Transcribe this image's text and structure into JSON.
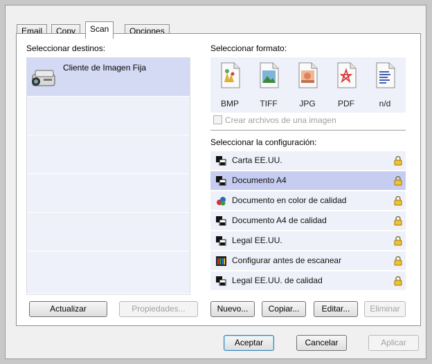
{
  "tabs": [
    {
      "label": "Email"
    },
    {
      "label": "Copy"
    },
    {
      "label": "Scan",
      "active": true
    },
    {
      "label": "Opciones"
    }
  ],
  "destinations": {
    "heading": "Seleccionar destinos:",
    "items": [
      "Cliente de Imagen Fija"
    ],
    "icon": "scanner-icon"
  },
  "format": {
    "heading": "Seleccionar formato:",
    "items": [
      {
        "label": "BMP",
        "icon": "bmp-file-icon"
      },
      {
        "label": "TIFF",
        "icon": "tiff-file-icon"
      },
      {
        "label": "JPG",
        "icon": "jpg-file-icon"
      },
      {
        "label": "PDF",
        "icon": "pdf-file-icon"
      },
      {
        "label": "n/d",
        "icon": "text-file-icon"
      }
    ],
    "single_image_label": "Crear archivos de una imagen",
    "single_image_checked": false
  },
  "configuration": {
    "heading": "Seleccionar la configuración:",
    "selected_index": 1,
    "items": [
      {
        "label": "Carta EE.UU.",
        "icon": "bw-document-icon"
      },
      {
        "label": "Documento A4",
        "icon": "bw-document-icon"
      },
      {
        "label": "Documento en color de calidad",
        "icon": "color-document-icon"
      },
      {
        "label": "Documento A4 de calidad",
        "icon": "bw-document-icon"
      },
      {
        "label": "Legal EE.UU.",
        "icon": "bw-document-icon"
      },
      {
        "label": "Configurar antes de escanear",
        "icon": "configure-icon"
      },
      {
        "label": "Legal EE.UU. de calidad",
        "icon": "bw-document-icon"
      }
    ],
    "lock_icon": "lock-icon",
    "colors": {
      "row": "#eef1f9",
      "selected_row": "#c6cdf1"
    }
  },
  "buttons": {
    "update": "Actualizar",
    "properties": "Propiedades...",
    "new": "Nuevo...",
    "copy": "Copiar...",
    "edit": "Editar...",
    "delete": "Eliminar",
    "ok": "Aceptar",
    "cancel": "Cancelar",
    "apply": "Aplicar"
  }
}
